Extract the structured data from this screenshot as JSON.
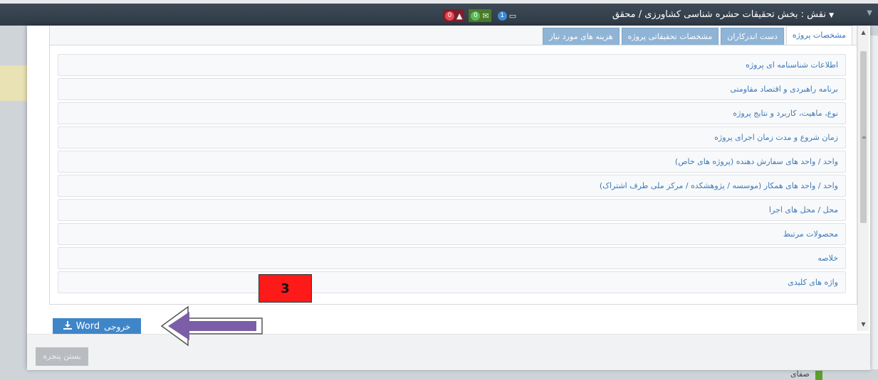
{
  "topbar": {
    "role_text": "نقش : بخش تحقیقات حشره شناسی کشاورزی / محقق",
    "badges": [
      {
        "count": "0",
        "icon": "bell-icon",
        "color": "#e8474d"
      },
      {
        "count": "0",
        "icon": "envelope-icon",
        "color": "#5cb85c"
      },
      {
        "count": "1",
        "icon": "inbox-icon",
        "color": "#3b8ad9"
      }
    ]
  },
  "modal": {
    "tabs": [
      {
        "label": "مشخصات پروژه",
        "active": true
      },
      {
        "label": "دست اندرکاران",
        "active": false
      },
      {
        "label": "مشخصات تحقیقاتی پروژه",
        "active": false
      },
      {
        "label": "هزینه های مورد نیاز",
        "active": false
      }
    ],
    "items": [
      "اطلاعات شناسنامه ای پروژه",
      "برنامه راهبردی و اقتصاد مقاومتی",
      "نوع، ماهیت، کاربرد و نتایج پروژه",
      "زمان شروع و مدت زمان اجرای پروژه",
      "واحد / واحد های سفارش دهنده (پروژه های خاص)",
      "واحد / واحد های همکار (موسسه / پژوهشکده / مرکز ملی طرف اشتراک)",
      "محل / محل های اجرا",
      "محصولات مرتبط",
      "خلاصه",
      "واژه های کلیدی"
    ],
    "export_button": {
      "label_main": "Word",
      "label_prefix": "خروجی",
      "icon": "download-icon"
    },
    "close_button": "بستن پنجره"
  },
  "annotation": {
    "number": "3",
    "color": "#ff1a1a",
    "arrow_color": "#7b5ea7"
  },
  "background": {
    "partial_text": "صفای"
  }
}
